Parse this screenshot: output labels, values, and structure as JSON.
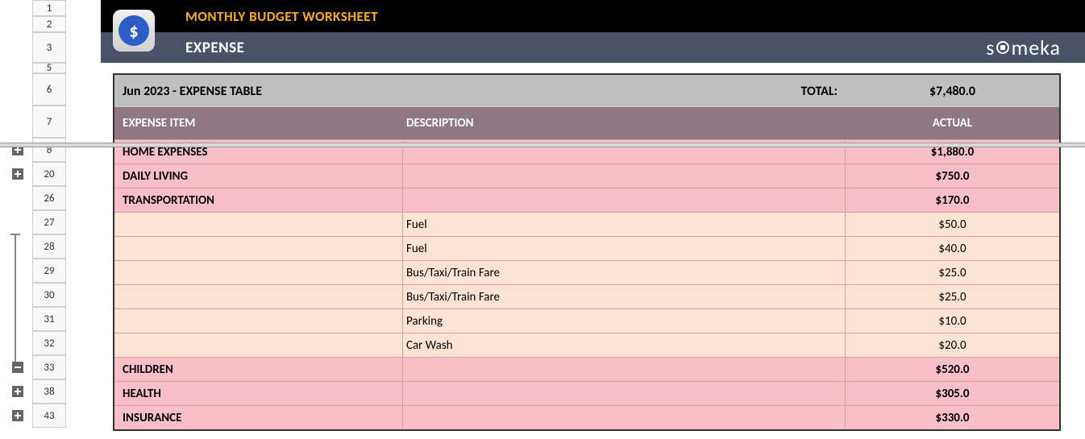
{
  "header": {
    "title": "MONTHLY BUDGET WORKSHEET",
    "subtitle": "EXPENSE",
    "logo_text_pre": "s",
    "logo_text_post": "meka"
  },
  "table": {
    "summary_label": "Jun 2023 - EXPENSE TABLE",
    "total_label": "TOTAL:",
    "total_value": "$7,480.0",
    "col1": "EXPENSE ITEM",
    "col2": "DESCRIPTION",
    "col3": "ACTUAL"
  },
  "rows": [
    {
      "type": "cat",
      "item": "HOME EXPENSES",
      "desc": "",
      "actual": "$1,880.0"
    },
    {
      "type": "cat",
      "item": "DAILY LIVING",
      "desc": "",
      "actual": "$750.0"
    },
    {
      "type": "cat",
      "item": "TRANSPORTATION",
      "desc": "",
      "actual": "$170.0"
    },
    {
      "type": "item",
      "item": "",
      "desc": "Fuel",
      "actual": "$50.0"
    },
    {
      "type": "item",
      "item": "",
      "desc": "Fuel",
      "actual": "$40.0"
    },
    {
      "type": "item",
      "item": "",
      "desc": "Bus/Taxi/Train Fare",
      "actual": "$25.0"
    },
    {
      "type": "item",
      "item": "",
      "desc": "Bus/Taxi/Train Fare",
      "actual": "$25.0"
    },
    {
      "type": "item",
      "item": "",
      "desc": "Parking",
      "actual": "$10.0"
    },
    {
      "type": "item",
      "item": "",
      "desc": "Car Wash",
      "actual": "$20.0"
    },
    {
      "type": "cat",
      "item": "CHILDREN",
      "desc": "",
      "actual": "$520.0"
    },
    {
      "type": "cat",
      "item": "HEALTH",
      "desc": "",
      "actual": "$305.0"
    },
    {
      "type": "cat",
      "item": "INSURANCE",
      "desc": "",
      "actual": "$330.0"
    }
  ],
  "rownums": [
    "1",
    "2",
    "3",
    "5",
    "6",
    "7",
    "8",
    "20",
    "26",
    "27",
    "28",
    "29",
    "30",
    "31",
    "32",
    "33",
    "38",
    "43"
  ],
  "outline_buttons": {
    "8": "plus",
    "20": "plus",
    "33": "minus",
    "38": "plus",
    "43": "plus"
  }
}
